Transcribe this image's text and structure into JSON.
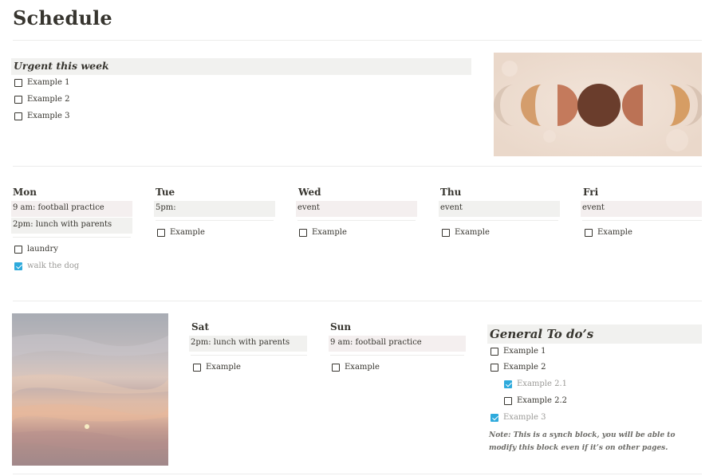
{
  "page": {
    "title": "Schedule"
  },
  "urgent": {
    "heading": "Urgent this week",
    "items": [
      {
        "label": "Example 1",
        "checked": false
      },
      {
        "label": "Example 2",
        "checked": false
      },
      {
        "label": "Example 3",
        "checked": false
      }
    ]
  },
  "days": {
    "mon": {
      "name": "Mon",
      "events": [
        "9 am: football practice",
        "2pm: lunch with parents"
      ],
      "todos": [
        {
          "label": "laundry",
          "checked": false
        },
        {
          "label": "walk the dog",
          "checked": true
        }
      ]
    },
    "tue": {
      "name": "Tue",
      "events": [
        "5pm:"
      ],
      "todos": [
        {
          "label": "Example",
          "checked": false
        }
      ]
    },
    "wed": {
      "name": "Wed",
      "events": [
        "event"
      ],
      "todos": [
        {
          "label": "Example",
          "checked": false
        }
      ]
    },
    "thu": {
      "name": "Thu",
      "events": [
        "event"
      ],
      "todos": [
        {
          "label": "Example",
          "checked": false
        }
      ]
    },
    "fri": {
      "name": "Fri",
      "events": [
        "event"
      ],
      "todos": [
        {
          "label": "Example",
          "checked": false
        }
      ]
    },
    "sat": {
      "name": "Sat",
      "events": [
        "2pm: lunch with parents"
      ],
      "todos": [
        {
          "label": "Example",
          "checked": false
        }
      ]
    },
    "sun": {
      "name": "Sun",
      "events": [
        "9 am: football practice"
      ],
      "todos": [
        {
          "label": "Example",
          "checked": false
        }
      ]
    }
  },
  "general": {
    "heading": "General To do’s",
    "items": [
      {
        "label": "Example 1",
        "checked": false
      },
      {
        "label": "Example 2",
        "checked": false
      },
      {
        "label": "Example 2.1",
        "checked": true
      },
      {
        "label": "Example 2.2",
        "checked": false
      },
      {
        "label": "Example 3",
        "checked": true
      }
    ],
    "note": "Note: This is a synch block, you will be able to modify this block even if it’s on other pages."
  },
  "images": {
    "moon": "moon-phases-illustration",
    "sky": "pastel-sky-photo"
  },
  "colors": {
    "checkbox_checked": "#2eaadc",
    "event_pink": "#f4efef",
    "event_gray": "#f1f1ef"
  }
}
